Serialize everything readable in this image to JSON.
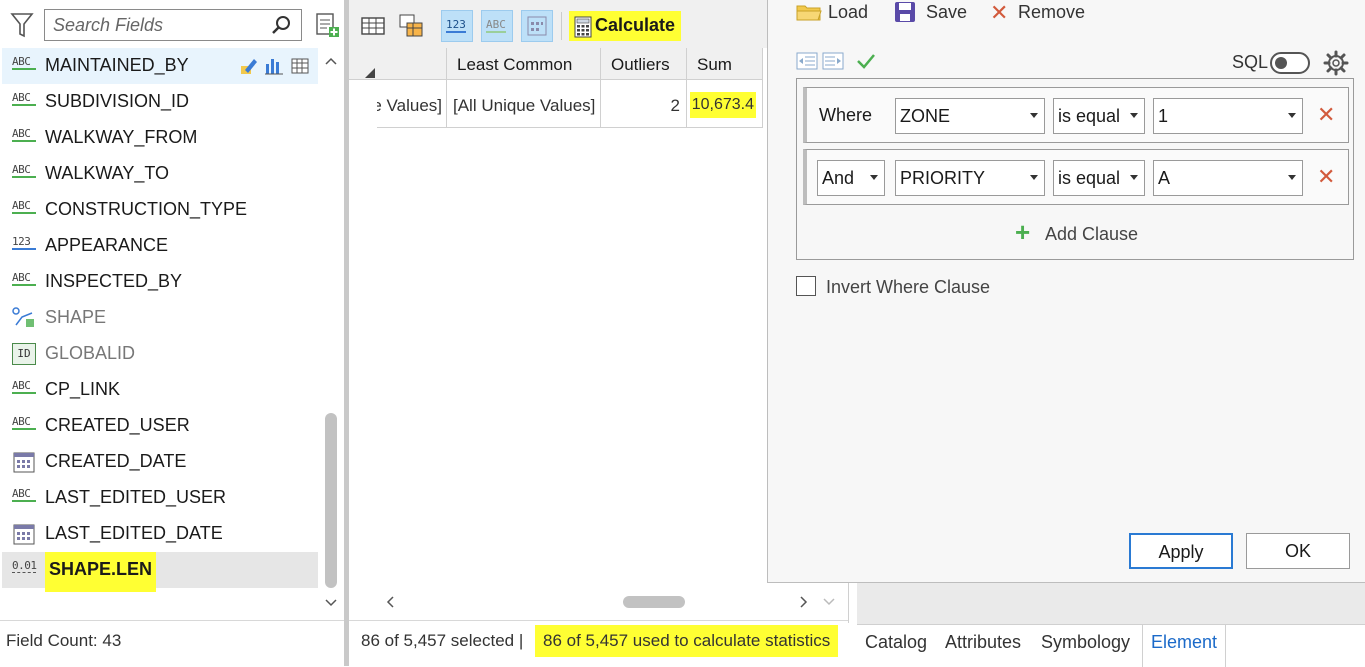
{
  "search": {
    "placeholder": "Search Fields"
  },
  "fields": [
    {
      "name": "MAINTAINED_BY",
      "type": "abc",
      "selected": true
    },
    {
      "name": "SUBDIVISION_ID",
      "type": "abc"
    },
    {
      "name": "WALKWAY_FROM",
      "type": "abc"
    },
    {
      "name": "WALKWAY_TO",
      "type": "abc"
    },
    {
      "name": "CONSTRUCTION_TYPE",
      "type": "abc"
    },
    {
      "name": "APPEARANCE",
      "type": "123"
    },
    {
      "name": "INSPECTED_BY",
      "type": "abc"
    },
    {
      "name": "SHAPE",
      "type": "shape",
      "grayed": true
    },
    {
      "name": "GLOBALID",
      "type": "id",
      "grayed": true
    },
    {
      "name": "CP_LINK",
      "type": "abc"
    },
    {
      "name": "CREATED_USER",
      "type": "abc"
    },
    {
      "name": "CREATED_DATE",
      "type": "date"
    },
    {
      "name": "LAST_EDITED_USER",
      "type": "abc"
    },
    {
      "name": "LAST_EDITED_DATE",
      "type": "date"
    },
    {
      "name": "SHAPE.LEN",
      "type": "double",
      "highlighted": true
    }
  ],
  "field_icons": {
    "abc": "ABC",
    "num": "123",
    "id": "ID",
    "dbl": "0.01"
  },
  "field_count": "Field Count: 43",
  "toolbar": {
    "calculate_label": "Calculate"
  },
  "table": {
    "headers": [
      "Least Common",
      "Outliers",
      "Sum"
    ],
    "row": {
      "partial": "e Values]",
      "least_common": "[All Unique Values]",
      "outliers": "2",
      "sum": "10,673.4"
    }
  },
  "status": {
    "selected": "86 of 5,457 selected |",
    "used": "86 of 5,457 used to calculate statistics"
  },
  "dialog": {
    "load_label": "Load",
    "save_label": "Save",
    "remove_label": "Remove",
    "sql_label": "SQL",
    "clauses": [
      {
        "connector": "Where",
        "field": "ZONE",
        "operator": "is equal",
        "value": "1"
      },
      {
        "connector": "And",
        "field": "PRIORITY",
        "operator": "is equal",
        "value": "A"
      }
    ],
    "add_clause_label": "Add Clause",
    "invert_label": "Invert Where Clause",
    "apply_label": "Apply",
    "ok_label": "OK"
  },
  "tabs": [
    "Catalog",
    "Attributes",
    "Symbology",
    "Element"
  ],
  "colors": {
    "highlight": "#ffff33",
    "accent": "#1b6ac9",
    "remove": "#d25a3c",
    "green": "#4caf50"
  }
}
